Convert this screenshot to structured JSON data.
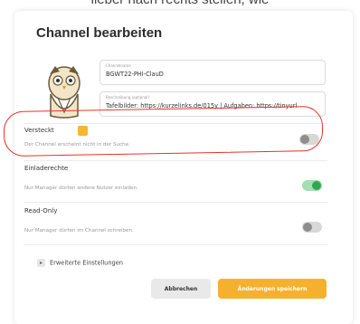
{
  "caption": "lieber nach rechts stellen, wie",
  "dialog": {
    "title": "Channel bearbeiten",
    "name_field": {
      "label": "Channelname",
      "value": "BGWT22-PHI-ClauD"
    },
    "description_field": {
      "label": "Beschreibung (optional)",
      "value": "Tafelbilder: https://kurzelinks.de/015y | Aufgaben: https://tinyurl"
    },
    "settings": [
      {
        "title": "Versteckt",
        "subtitle": "Der Channel erscheint nicht in der Suche.",
        "enabled": false
      },
      {
        "title": "Einladerechte",
        "subtitle": "Nur Manager dürfen andere Nutzer einladen.",
        "enabled": true
      },
      {
        "title": "Read-Only",
        "subtitle": "Nur Manager dürfen im Channel schreiben.",
        "enabled": false
      }
    ],
    "advanced_label": "Erweiterte Einstellungen",
    "cancel_label": "Abbrechen",
    "save_label": "Änderungen speichern"
  },
  "colors": {
    "accent": "#f5b12e",
    "toggle_on": "#2fa84f",
    "highlight": "#e5342a"
  }
}
